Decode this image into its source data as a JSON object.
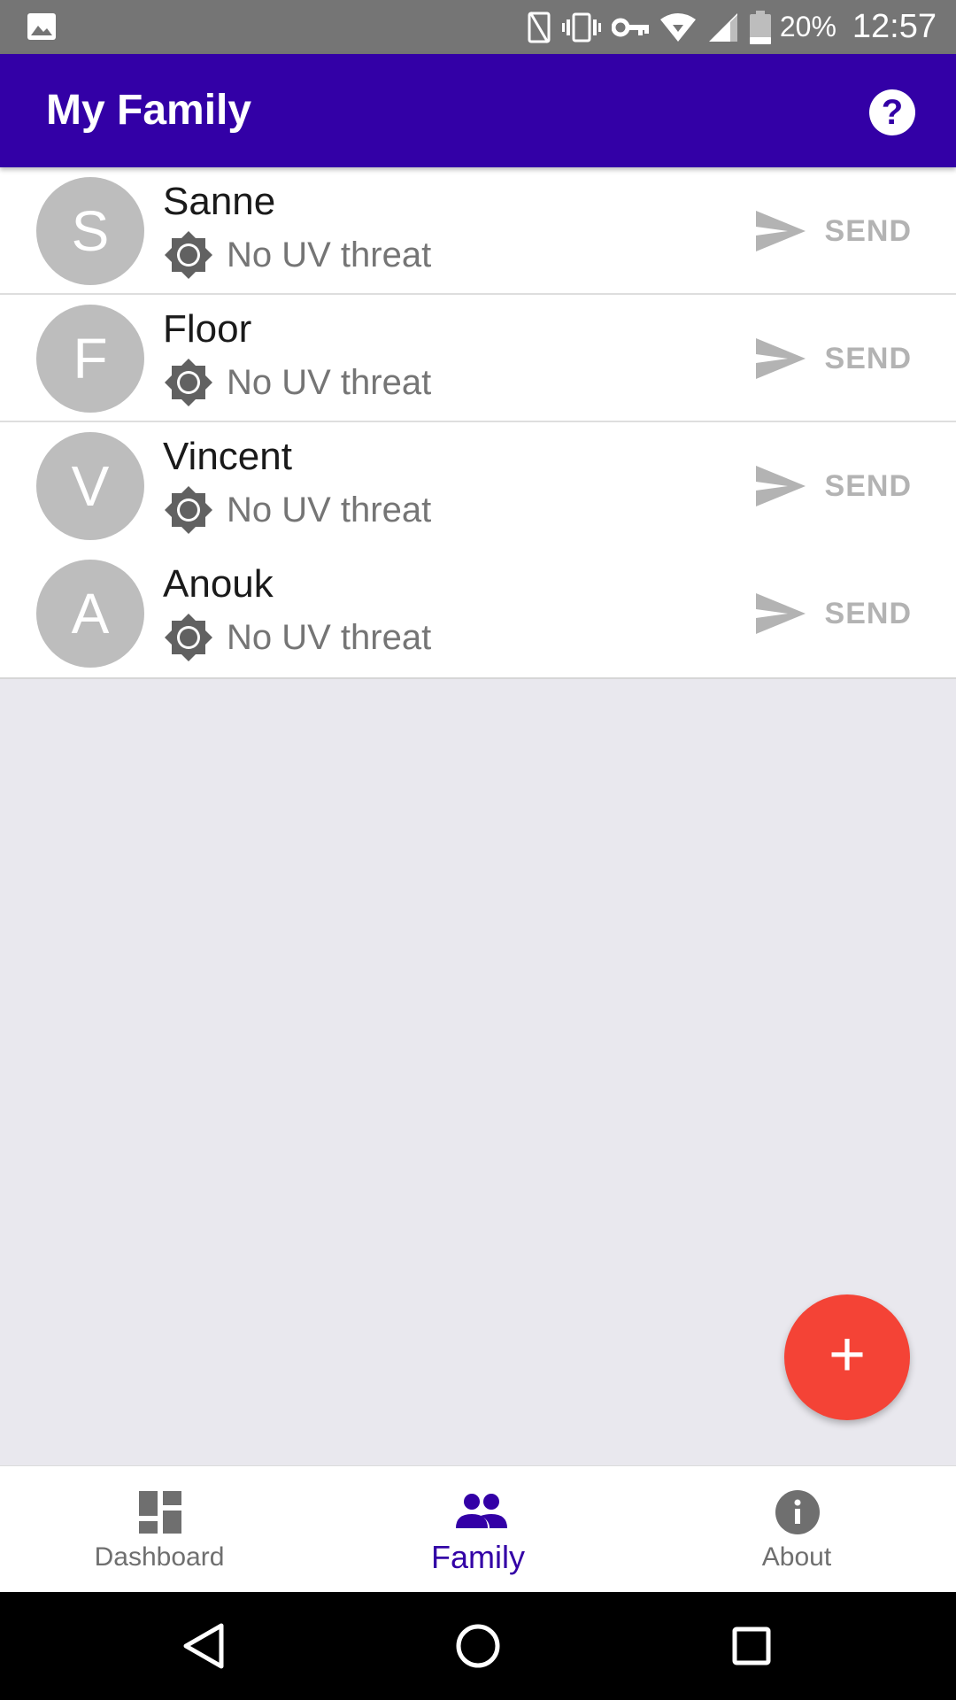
{
  "status_bar": {
    "battery_text": "20%",
    "time": "12:57",
    "color": "#757575"
  },
  "app_bar": {
    "title": "My Family",
    "help_label": "?",
    "color": "#3300a6"
  },
  "members": [
    {
      "initial": "S",
      "name": "Sanne",
      "uv_status": "No UV threat",
      "send_label": "SEND"
    },
    {
      "initial": "F",
      "name": "Floor",
      "uv_status": "No UV threat",
      "send_label": "SEND"
    },
    {
      "initial": "V",
      "name": "Vincent",
      "uv_status": "No UV threat",
      "send_label": "SEND"
    },
    {
      "initial": "A",
      "name": "Anouk",
      "uv_status": "No UV threat",
      "send_label": "SEND"
    }
  ],
  "fab": {
    "label": "+",
    "color": "#f44336"
  },
  "bottom_nav": {
    "items": [
      {
        "label": "Dashboard",
        "icon": "dashboard-icon",
        "active": false
      },
      {
        "label": "Family",
        "icon": "family-icon",
        "active": true
      },
      {
        "label": "About",
        "icon": "info-icon",
        "active": false
      }
    ],
    "active_color": "#3300a6"
  },
  "system_nav": {
    "buttons": [
      "back-icon",
      "home-icon",
      "recents-icon"
    ]
  }
}
